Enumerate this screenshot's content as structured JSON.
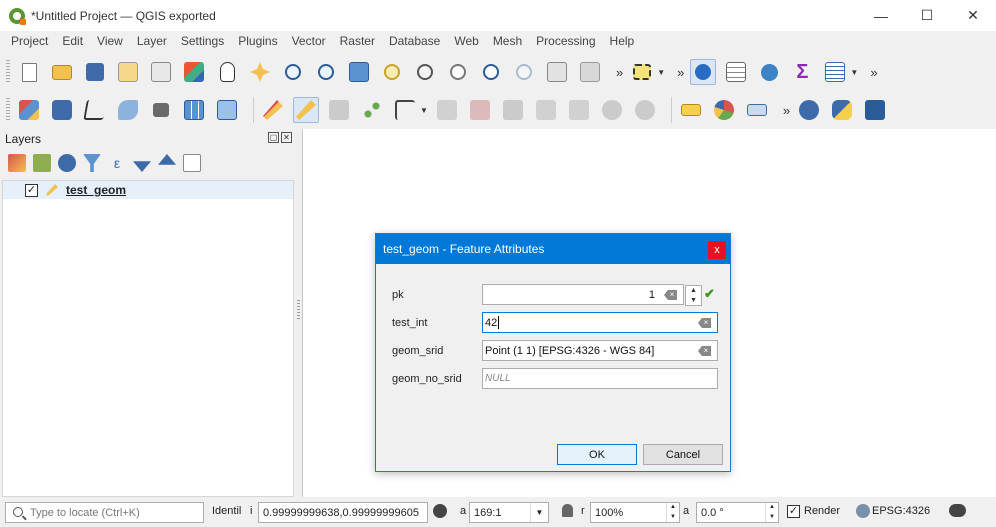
{
  "window": {
    "title": "*Untitled Project — QGIS exported",
    "minimize": "—",
    "maximize": "☐",
    "close": "✕"
  },
  "menu": [
    "Project",
    "Edit",
    "View",
    "Layer",
    "Settings",
    "Plugins",
    "Vector",
    "Raster",
    "Database",
    "Web",
    "Mesh",
    "Processing",
    "Help"
  ],
  "toolbar": {
    "overflow": "»"
  },
  "layers_panel": {
    "title": "Layers",
    "float_btn": "▢",
    "close_btn": "✕",
    "layer": {
      "name": "test_geom",
      "checked": "✓"
    }
  },
  "dialog": {
    "title": "test_geom - Feature Attributes",
    "close": "x",
    "fields": [
      {
        "label": "pk",
        "value": "1"
      },
      {
        "label": "test_int",
        "value": "42"
      },
      {
        "label": "geom_srid",
        "value": "Point (1 1) [EPSG:4326 - WGS 84]"
      },
      {
        "label": "geom_no_srid",
        "value": "NULL"
      }
    ],
    "ok_label": "OK",
    "cancel_label": "Cancel",
    "valid_mark": "✔"
  },
  "statusbar": {
    "locate_placeholder": "Type to locate (Ctrl+K)",
    "identify_label": "Identil",
    "coord_label": "i",
    "coordinate": "0.99999999638,0.99999999605",
    "scale_label": "a",
    "scale": "169:1",
    "mag_label": "r",
    "magnifier": "100%",
    "rot_label": "a",
    "rotation": "0.0 °",
    "render_label": "Render",
    "render_checked": "✓",
    "crs": "EPSG:4326"
  },
  "colors": {
    "accent": "#0078d7",
    "close_red": "#e81123",
    "valid_green": "#3a9a1b",
    "qgis_green": "#589632"
  }
}
